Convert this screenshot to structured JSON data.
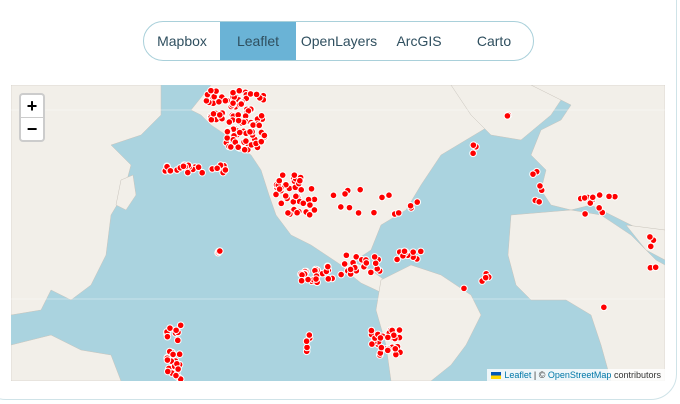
{
  "tabs": [
    {
      "label": "Mapbox"
    },
    {
      "label": "Leaflet",
      "active": true
    },
    {
      "label": "OpenLayers"
    },
    {
      "label": "ArcGIS"
    },
    {
      "label": "Carto"
    }
  ],
  "zoom": {
    "in": "+",
    "out": "−"
  },
  "attribution": {
    "leaflet": "Leaflet",
    "sep": "| ©",
    "osm": "OpenStreetMap",
    "suffix": "contributors"
  },
  "colors": {
    "ocean": "#aad3df",
    "land": "#f2efe9",
    "marker": "#ff0000",
    "active_tab": "#6ab3d6"
  }
}
